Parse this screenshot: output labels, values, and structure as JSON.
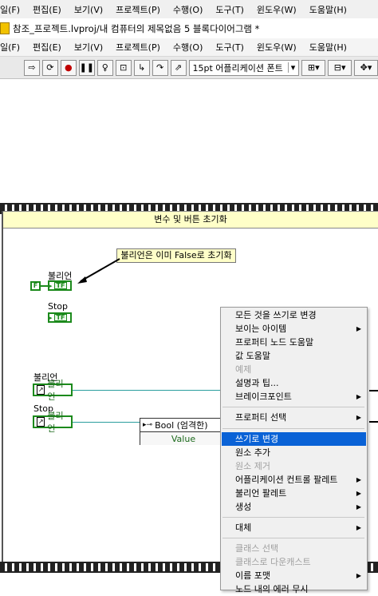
{
  "background_menu": [
    "일(F)",
    "편집(E)",
    "보기(V)",
    "프로젝트(P)",
    "수행(O)",
    "도구(T)",
    "윈도우(W)",
    "도움말(H)"
  ],
  "window_title": "참조_프로젝트.lvproj/내 컴퓨터의 제목없음 5 블록다이어그램 *",
  "menu": [
    "일(F)",
    "편집(E)",
    "보기(V)",
    "프로젝트(P)",
    "수행(O)",
    "도구(T)",
    "윈도우(W)",
    "도움말(H)"
  ],
  "toolbar": {
    "icons": [
      "run-arrow-icon",
      "run-continuous-icon",
      "abort-icon",
      "pause-icon",
      "highlight-execution-icon",
      "retain-wire-values-icon",
      "step-into-icon",
      "step-over-icon",
      "step-out-icon"
    ],
    "font_label": "15pt 어플리케이션 폰트",
    "font_dropdown_arrow": "▾",
    "align_icons": [
      "align-objects-icon",
      "distribute-objects-icon",
      "reorder-icon"
    ]
  },
  "diagram": {
    "frame_title": "변수 및 버튼 초기화",
    "comment": "불리언은 이미 False로 초기화",
    "bool_label_1": "불리언",
    "bool_false_const": "F",
    "tf_text": "TF",
    "stop_label_1": "Stop",
    "local_bool_label": "불리언",
    "local_bool_text": "불리언",
    "local_stop_label": "Stop",
    "local_stop_text": "불리언",
    "property_node_title": "Bool (엄격한)",
    "property_node_value": "Value"
  },
  "context_menu": {
    "items": [
      {
        "label": "모든 것을 쓰기로 변경",
        "state": "enabled",
        "submenu": false
      },
      {
        "label": "보이는 아이템",
        "state": "enabled",
        "submenu": true
      },
      {
        "label": "프로퍼티 노드 도움말",
        "state": "enabled",
        "submenu": false
      },
      {
        "label": "값 도움말",
        "state": "enabled",
        "submenu": false
      },
      {
        "label": "예제",
        "state": "disabled",
        "submenu": false
      },
      {
        "label": "설명과 팁...",
        "state": "enabled",
        "submenu": false
      },
      {
        "label": "브레이크포인트",
        "state": "enabled",
        "submenu": true
      },
      {
        "label": "프로퍼티 선택",
        "state": "enabled",
        "submenu": true
      },
      {
        "label": "쓰기로 변경",
        "state": "selected",
        "submenu": false
      },
      {
        "label": "원소 추가",
        "state": "enabled",
        "submenu": false
      },
      {
        "label": "원소 제거",
        "state": "disabled",
        "submenu": false
      },
      {
        "label": "어플리케이션 컨트롤 팔레트",
        "state": "enabled",
        "submenu": true
      },
      {
        "label": "불리언 팔레트",
        "state": "enabled",
        "submenu": true
      },
      {
        "label": "생성",
        "state": "enabled",
        "submenu": true
      },
      {
        "label": "대체",
        "state": "enabled",
        "submenu": true
      },
      {
        "label": "클래스 선택",
        "state": "disabled",
        "submenu": false
      },
      {
        "label": "클래스로 다운캐스트",
        "state": "disabled",
        "submenu": false
      },
      {
        "label": "이름 포맷",
        "state": "enabled",
        "submenu": true
      },
      {
        "label": "노드 내의 에러 무시",
        "state": "enabled",
        "submenu": false
      }
    ],
    "submenu_arrow": "▶"
  },
  "colors": {
    "selection": "#0a62d6",
    "boolean_green": "#1c8a1c",
    "wire": "#2a9e9e",
    "frame_title_bg": "#ffffc8"
  }
}
